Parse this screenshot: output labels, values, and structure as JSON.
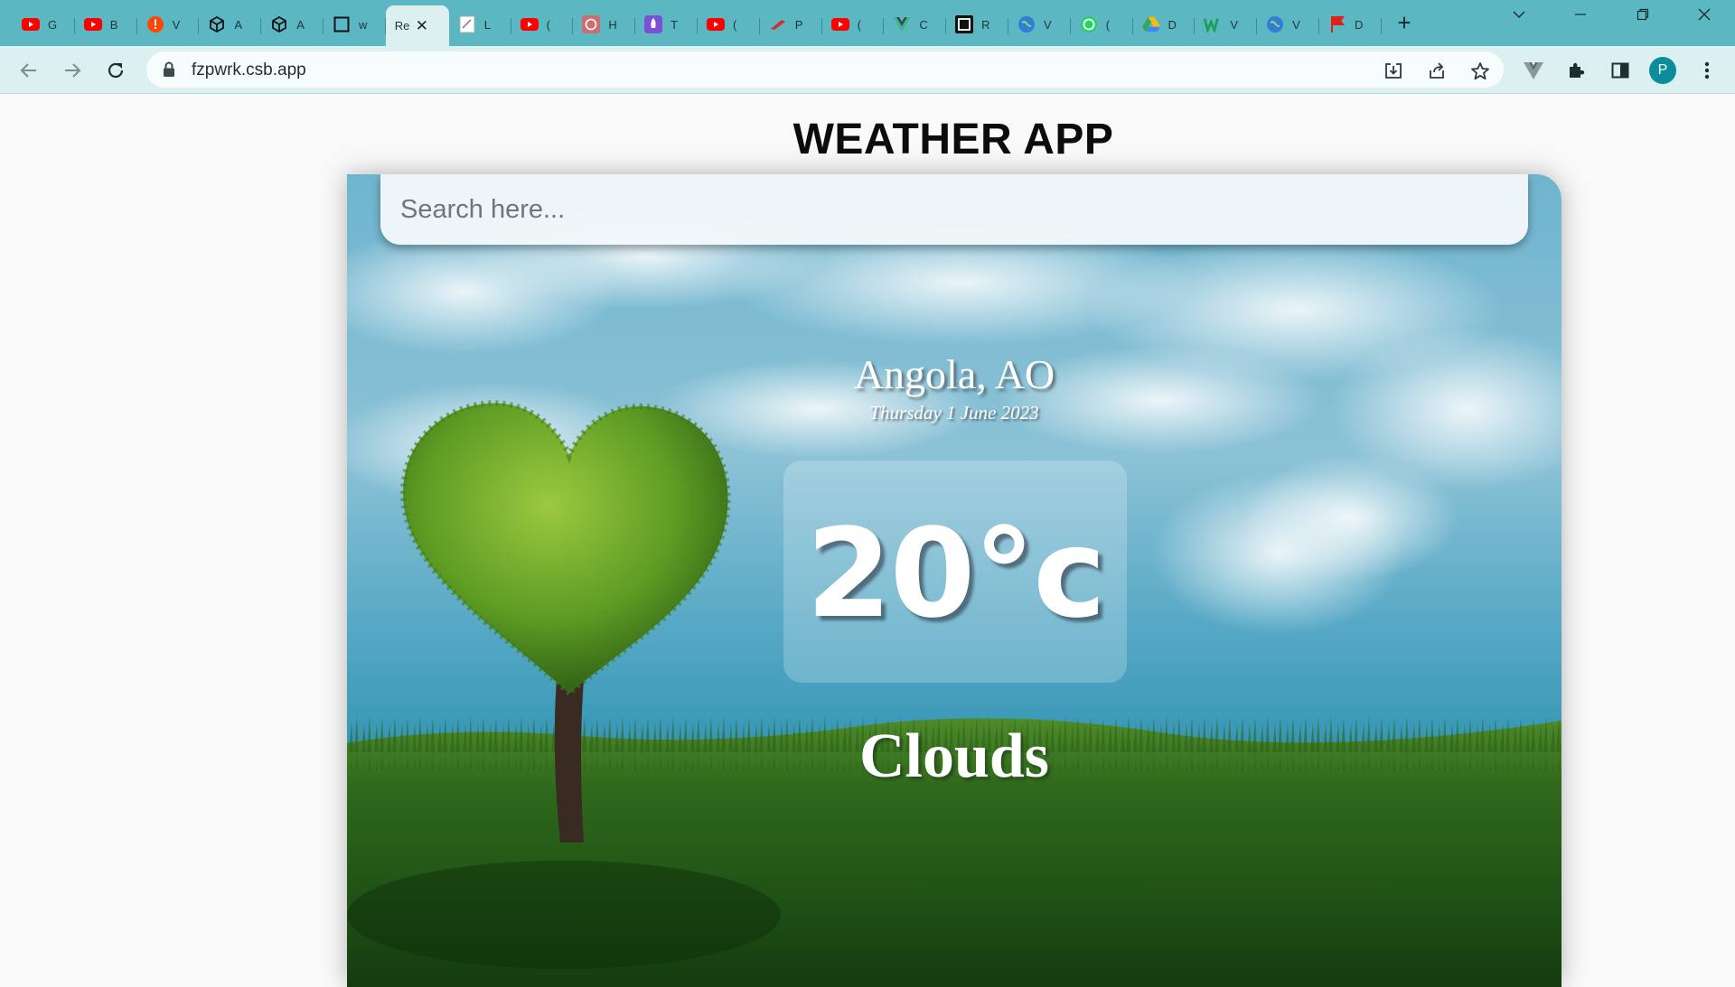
{
  "browser": {
    "tabs": [
      {
        "title": "G",
        "icon": "youtube-icon"
      },
      {
        "title": "B",
        "icon": "youtube-icon"
      },
      {
        "title": "V",
        "icon": "alert-icon"
      },
      {
        "title": "A",
        "icon": "codesandbox-icon"
      },
      {
        "title": "A",
        "icon": "codesandbox-icon"
      },
      {
        "title": "w",
        "icon": "square-icon"
      },
      {
        "title": "Re",
        "icon": "none",
        "active": true
      },
      {
        "title": "L",
        "icon": "page-icon"
      },
      {
        "title": "(",
        "icon": "youtube-icon"
      },
      {
        "title": "H",
        "icon": "chatgpt-icon"
      },
      {
        "title": "T",
        "icon": "rocket-icon"
      },
      {
        "title": "(",
        "icon": "youtube-icon"
      },
      {
        "title": "P",
        "icon": "pen-icon"
      },
      {
        "title": "(",
        "icon": "youtube-icon"
      },
      {
        "title": "C",
        "icon": "vue-icon"
      },
      {
        "title": "R",
        "icon": "terminal-icon"
      },
      {
        "title": "V",
        "icon": "globe-icon"
      },
      {
        "title": "(",
        "icon": "whatsapp-icon"
      },
      {
        "title": "D",
        "icon": "drive-icon"
      },
      {
        "title": "V",
        "icon": "w-icon"
      },
      {
        "title": "V",
        "icon": "globe-icon"
      },
      {
        "title": "D",
        "icon": "flag-icon"
      }
    ],
    "url": "fzpwrk.csb.app",
    "profile_initial": "P",
    "accent": "#5bb8c2"
  },
  "app": {
    "title": "WEATHER APP",
    "search_placeholder": "Search here...",
    "location": "Angola, AO",
    "date": "Thursday 1 June 2023",
    "temperature": "20°c",
    "condition": "Clouds"
  }
}
